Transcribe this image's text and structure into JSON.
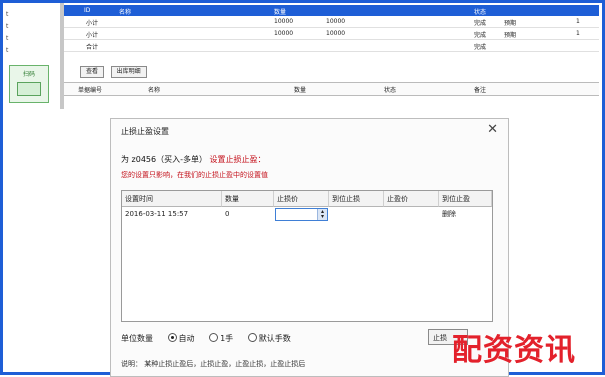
{
  "left_panel": {
    "texts": [
      "t",
      "t",
      "t",
      "t"
    ],
    "green_box_label": "扫码"
  },
  "grid": {
    "header": [
      "ID",
      "名称",
      "",
      "",
      "",
      "数量",
      "",
      "",
      "状态",
      "",
      "",
      ""
    ],
    "rows": [
      [
        "",
        "小计",
        "",
        "",
        "",
        "10000",
        "10000",
        "",
        "完成",
        "",
        "预期",
        "1"
      ],
      [
        "",
        "小计",
        "",
        "",
        "",
        "10000",
        "10000",
        "",
        "完成",
        "",
        "预期",
        "1"
      ],
      [
        "",
        "合计",
        "",
        "",
        "",
        "",
        "",
        "",
        "完成",
        "",
        "",
        ""
      ]
    ],
    "left_numbers": [
      "",
      "",
      "",
      ""
    ]
  },
  "tabs": [
    "查看",
    "出库明细"
  ],
  "sub_header": [
    "单据编号",
    "名称",
    "",
    "数量",
    "",
    "",
    "状态",
    "",
    "备注",
    "",
    "",
    ""
  ],
  "dialog": {
    "title": "止损止盈设置",
    "line1_prefix": "为",
    "line1_code": "z0456（买入-多单）",
    "line1_suffix": "设置止损止盈：",
    "warning": "您的设置只影响，在我们的止损止盈中的设置值",
    "columns": [
      "设置时间",
      "数量",
      "止损价",
      "到位止损",
      "止盈价",
      "到位止盈"
    ],
    "row": {
      "time": "2016-03-11 15:57",
      "qty": "0",
      "action": "删除"
    },
    "radio_label": "单位数量",
    "radio_options": [
      "自动",
      "1手",
      "默认手数"
    ],
    "selected_radio": 0,
    "ok_button": "止损",
    "bottom_text": "说明：   某种止损止盈后，止损止盈，止盈止损，止盈止损后"
  },
  "watermark": "配资资讯",
  "colors": {
    "frame": "#1e5ed6",
    "header_blue": "#1e5ed6",
    "warning_red": "#c4111b",
    "watermark_red": "#e3212b",
    "green": "#69b36b"
  }
}
